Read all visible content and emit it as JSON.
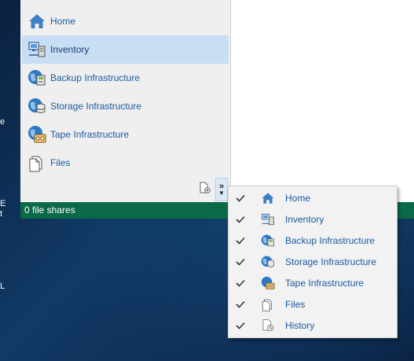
{
  "nav": {
    "items": [
      {
        "label": "Home",
        "icon": "home-icon"
      },
      {
        "label": "Inventory",
        "icon": "inventory-icon",
        "selected": true
      },
      {
        "label": "Backup Infrastructure",
        "icon": "backup-infrastructure-icon"
      },
      {
        "label": "Storage Infrastructure",
        "icon": "storage-infrastructure-icon"
      },
      {
        "label": "Tape Infrastructure",
        "icon": "tape-infrastructure-icon"
      },
      {
        "label": "Files",
        "icon": "files-icon"
      }
    ],
    "configure_icon": "configure-buttons-icon",
    "more_icon": "chevron-double-right-icon"
  },
  "status_bar": {
    "text": "0 file shares"
  },
  "menu": {
    "items": [
      {
        "label": "Home",
        "checked": true,
        "icon": "home-icon"
      },
      {
        "label": "Inventory",
        "checked": true,
        "icon": "inventory-icon"
      },
      {
        "label": "Backup Infrastructure",
        "checked": true,
        "icon": "backup-infrastructure-icon"
      },
      {
        "label": "Storage Infrastructure",
        "checked": true,
        "icon": "storage-infrastructure-icon"
      },
      {
        "label": "Tape Infrastructure",
        "checked": true,
        "icon": "tape-infrastructure-icon"
      },
      {
        "label": "Files",
        "checked": true,
        "icon": "files-icon"
      },
      {
        "label": "History",
        "checked": true,
        "icon": "history-icon"
      }
    ]
  },
  "desktop_fragments": [
    "e",
    "E",
    "t",
    "L"
  ],
  "colors": {
    "nav_text": "#1c5aa0",
    "selected_bg": "#c7def5",
    "status_bg": "#0a6a47",
    "desktop_bg": "#0f2a4d"
  }
}
